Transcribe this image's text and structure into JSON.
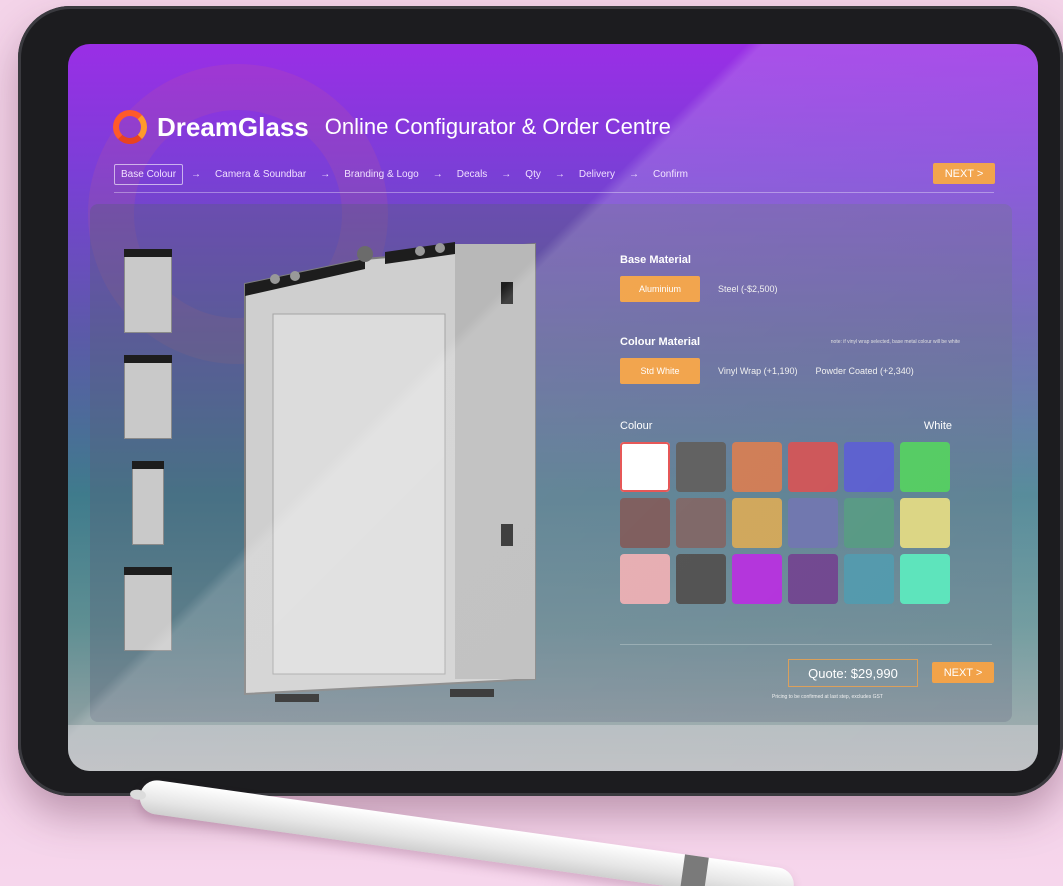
{
  "brand": {
    "name": "DreamGlass",
    "subtitle": "Online Configurator & Order Centre"
  },
  "steps": [
    "Base Colour",
    "Camera & Soundbar",
    "Branding & Logo",
    "Decals",
    "Qty",
    "Delivery",
    "Confirm"
  ],
  "arrow": "→",
  "next_label": "NEXT >",
  "base_material": {
    "label": "Base Material",
    "selected": "Aluminium",
    "other": "Steel (-$2,500)"
  },
  "colour_material": {
    "label": "Colour Material",
    "note": "note: if vinyl wrap selected, base metal colour will be white",
    "selected": "Std White",
    "option_2": "Vinyl Wrap (+1,190)",
    "option_3": "Powder Coated (+2,340)"
  },
  "colour": {
    "label": "Colour",
    "selected_name": "White",
    "swatches": [
      "#ffffff",
      "#474747",
      "#c8693c",
      "#c63c40",
      "#4448c7",
      "#3cc44c",
      "#6a4444",
      "#6b5050",
      "#c99a42",
      "#5a62a2",
      "#3f8a72",
      "#d7d072",
      "#e3a1a6",
      "#383838",
      "#a815d6",
      "#5c2c7f",
      "#3a8aa0",
      "#45e0b2"
    ]
  },
  "quote": {
    "label": "Quote: $29,990",
    "note": "Pricing to be confirmed at last step, excludes GST"
  },
  "colors": {
    "accent": "#f0952e",
    "selected_outline": "#e23a3a"
  }
}
